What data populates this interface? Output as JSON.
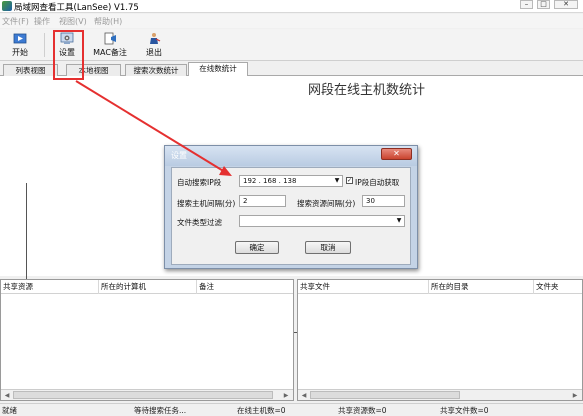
{
  "window": {
    "title": "局域网查看工具(LanSee) V1.75",
    "controls": {
      "minimize": "–",
      "maximize": "□",
      "close": "✕"
    }
  },
  "menu": [
    "文件(F)",
    "操作",
    "视图(V)",
    "帮助(H)"
  ],
  "toolbar": {
    "start_label": "开始",
    "settings_label": "设置",
    "mac_label": "MAC备注",
    "exit_label": "退出",
    "icons": [
      "play-icon",
      "settings-icon",
      "mac-note-icon",
      "exit-icon"
    ]
  },
  "tabs": [
    "列表视图",
    "本地视图",
    "搜索次数统计",
    "在线数统计"
  ],
  "active_tab": 3,
  "chart": {
    "title": "网段在线主机数统计"
  },
  "left_pane": {
    "columns": [
      "共享资源",
      "所在的计算机",
      "备注"
    ]
  },
  "right_pane": {
    "columns": [
      "共享文件",
      "所在的目录",
      "文件夹"
    ]
  },
  "status": [
    "就绪",
    "等待搜索任务...",
    "在线主机数=0",
    "共享资源数=0",
    "共享文件数=0"
  ],
  "dialog": {
    "title": "设置",
    "close": "✕",
    "auto_ip_label": "自动搜索IP段",
    "auto_ip_value": "192 . 168 . 138",
    "auto_get_label": "IP段自动获取",
    "auto_get_checked": true,
    "scan_interval_label": "搜索主机间隔(分)",
    "scan_interval_value": "2",
    "resource_interval_label": "搜索资源间隔(分)",
    "resource_interval_value": "30",
    "file_filter_label": "文件类型过滤",
    "file_filter_value": "",
    "ok_label": "确定",
    "cancel_label": "取消"
  },
  "colors": {
    "highlight": "#e53030",
    "dialog_frame": "#c4d3e6",
    "close_button": "#c9432e"
  }
}
